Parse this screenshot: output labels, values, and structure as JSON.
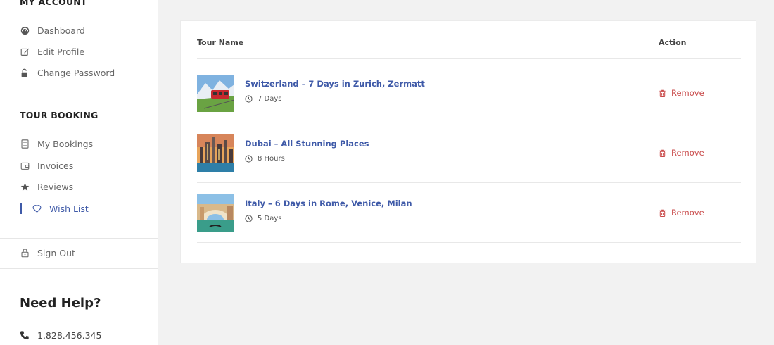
{
  "sidebar": {
    "account_title": "MY ACCOUNT",
    "account_items": [
      {
        "label": "Dashboard",
        "icon": "dashboard-icon"
      },
      {
        "label": "Edit Profile",
        "icon": "edit-icon"
      },
      {
        "label": "Change Password",
        "icon": "lock-icon"
      }
    ],
    "booking_title": "TOUR BOOKING",
    "booking_items": [
      {
        "label": "My Bookings",
        "icon": "document-icon"
      },
      {
        "label": "Invoices",
        "icon": "wallet-icon"
      },
      {
        "label": "Reviews",
        "icon": "star-icon"
      },
      {
        "label": "Wish List",
        "icon": "heart-icon",
        "active": true
      }
    ],
    "signout_label": "Sign Out",
    "help_title": "Need Help?",
    "phone": "1.828.456.345"
  },
  "table": {
    "col_tour": "Tour Name",
    "col_action": "Action",
    "rows": [
      {
        "title": "Switzerland – 7 Days in Zurich, Zermatt",
        "duration": "7 Days",
        "action": "Remove"
      },
      {
        "title": "Dubai – All Stunning Places",
        "duration": "8 Hours",
        "action": "Remove"
      },
      {
        "title": "Italy – 6 Days in Rome, Venice, Milan",
        "duration": "5 Days",
        "action": "Remove"
      }
    ]
  },
  "colors": {
    "accent": "#3f5aa8",
    "danger": "#c94a4a",
    "page_bg": "#f2f2f2"
  }
}
